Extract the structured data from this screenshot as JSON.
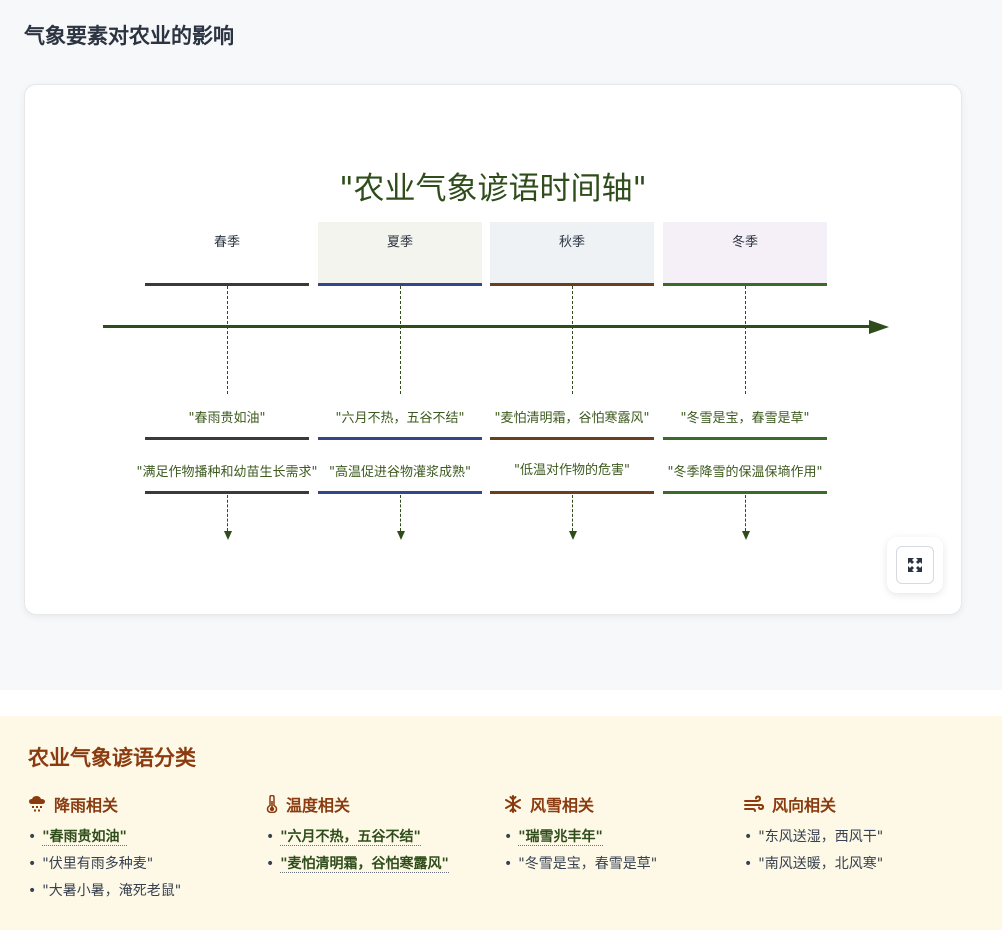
{
  "page_title": "气象要素对农业的影响",
  "diagram": {
    "title": "\"农业气象谚语时间轴\"",
    "seasons": [
      {
        "name": "春季",
        "color": "#3a3a3a",
        "bg": "#ffffff",
        "proverb": "\"春雨贵如油\"",
        "effect": "\"满足作物播种和幼苗生长需求\""
      },
      {
        "name": "夏季",
        "color": "#36458a",
        "bg": "#f4f4ee",
        "proverb": "\"六月不热，五谷不结\"",
        "effect": "\"高温促进谷物灌浆成熟\""
      },
      {
        "name": "秋季",
        "color": "#6b3e1f",
        "bg": "#eef2f4",
        "proverb": "\"麦怕清明霜，谷怕寒露风\"",
        "effect": "\"低温对作物的危害\""
      },
      {
        "name": "冬季",
        "color": "#3a6b28",
        "bg": "#f5f0f8",
        "proverb": "\"冬雪是宝，春雪是草\"",
        "effect": "\"冬季降雪的保温保墒作用\""
      }
    ],
    "expand_icon": "expand-icon"
  },
  "categories_section": {
    "title": "农业气象谚语分类",
    "categories": [
      {
        "name": "降雨相关",
        "icon": "rain-cloud-icon",
        "items": [
          {
            "text": "\"春雨贵如油\"",
            "highlight": true
          },
          {
            "text": "\"伏里有雨多种麦\"",
            "highlight": false
          },
          {
            "text": "\"大暑小暑，淹死老鼠\"",
            "highlight": false
          }
        ]
      },
      {
        "name": "温度相关",
        "icon": "thermometer-icon",
        "items": [
          {
            "text": "\"六月不热，五谷不结\"",
            "highlight": true
          },
          {
            "text": "\"麦怕清明霜，谷怕寒露风\"",
            "highlight": true
          }
        ]
      },
      {
        "name": "风雪相关",
        "icon": "snowflake-icon",
        "items": [
          {
            "text": "\"瑞雪兆丰年\"",
            "highlight": true
          },
          {
            "text": "\"冬雪是宝，春雪是草\"",
            "highlight": false
          }
        ]
      },
      {
        "name": "风向相关",
        "icon": "wind-icon",
        "items": [
          {
            "text": "\"东风送湿，西风干\"",
            "highlight": false
          },
          {
            "text": "\"南风送暖，北风寒\"",
            "highlight": false
          }
        ]
      }
    ]
  }
}
